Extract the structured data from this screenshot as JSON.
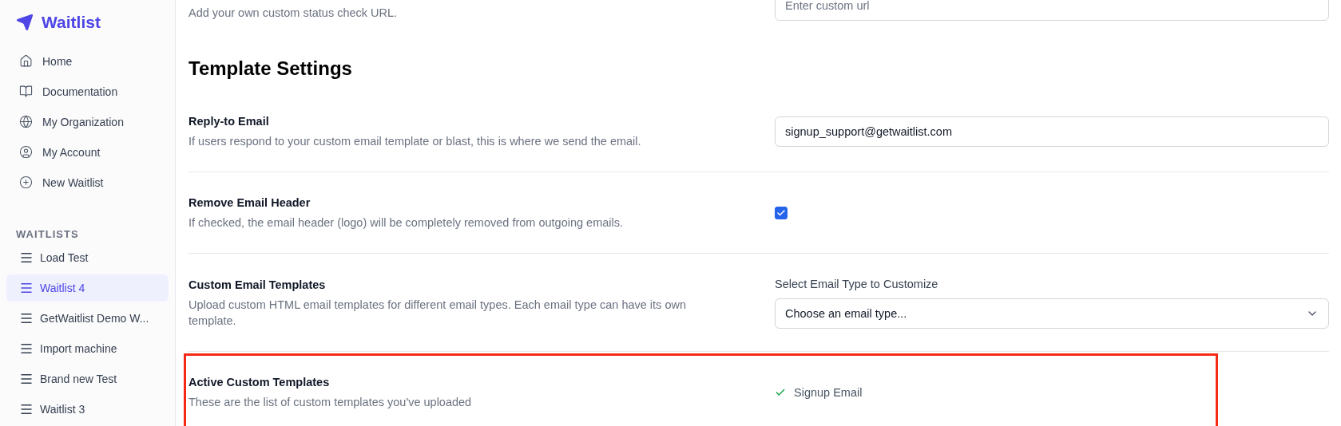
{
  "sidebar": {
    "brand": "Waitlist",
    "nav": [
      {
        "kind": "home",
        "label": "Home"
      },
      {
        "kind": "book",
        "label": "Documentation"
      },
      {
        "kind": "globe",
        "label": "My Organization"
      },
      {
        "kind": "user",
        "label": "My Account"
      },
      {
        "kind": "plus",
        "label": "New Waitlist"
      }
    ],
    "section_title": "WAITLISTS",
    "waitlists": [
      {
        "label": "Load Test",
        "selected": false
      },
      {
        "label": "Waitlist 4",
        "selected": true
      },
      {
        "label": "GetWaitlist Demo W...",
        "selected": false
      },
      {
        "label": "Import machine",
        "selected": false
      },
      {
        "label": "Brand new Test",
        "selected": false
      },
      {
        "label": "Waitlist 3",
        "selected": false
      }
    ]
  },
  "partial_row": {
    "description": "Add your own custom status check URL.",
    "placeholder": "Enter custom url"
  },
  "section": {
    "title": "Template Settings"
  },
  "rows": [
    {
      "kind": "text",
      "highlighted": false,
      "title": "Reply-to Email",
      "description": "If users respond to your custom email template or blast, this is where we send the email.",
      "value": "signup_support@getwaitlist.com"
    },
    {
      "kind": "checkbox",
      "highlighted": false,
      "title": "Remove Email Header",
      "description": "If checked, the email header (logo) will be completely removed from outgoing emails.",
      "checked": true
    },
    {
      "kind": "select",
      "highlighted": false,
      "title": "Custom Email Templates",
      "description": "Upload custom HTML email templates for different email types. Each email type can have its own template.",
      "field_label": "Select Email Type to Customize",
      "value": "Choose an email type..."
    },
    {
      "kind": "list",
      "highlighted": true,
      "title": "Active Custom Templates",
      "description": "These are the list of custom templates you've uploaded",
      "items": [
        "Signup Email"
      ]
    }
  ]
}
